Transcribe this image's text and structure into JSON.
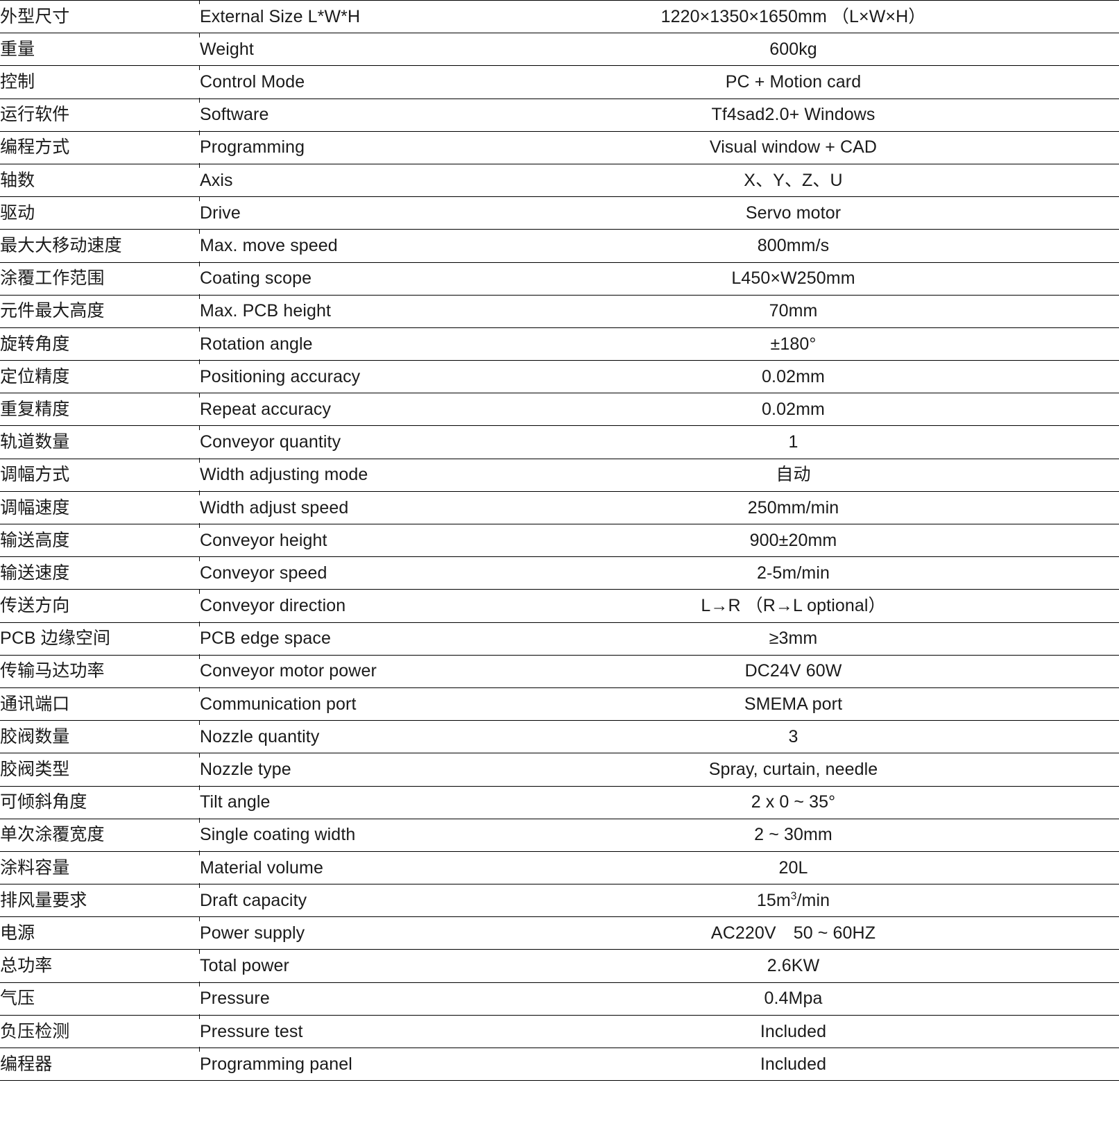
{
  "table": {
    "columns": [
      "label_cn",
      "label_en",
      "value"
    ],
    "rows": [
      {
        "label_cn": "外型尺寸",
        "label_en": "External Size L*W*H",
        "value": "1220×1350×1650mm （L×W×H）"
      },
      {
        "label_cn": "重量",
        "label_en": "Weight",
        "value": "600kg"
      },
      {
        "label_cn": "控制",
        "label_en": "Control Mode",
        "value": "PC + Motion card"
      },
      {
        "label_cn": "运行软件",
        "label_en": "Software",
        "value": "Tf4sad2.0+ Windows"
      },
      {
        "label_cn": "编程方式",
        "label_en": "Programming",
        "value": "Visual window + CAD"
      },
      {
        "label_cn": "轴数",
        "label_en": "Axis",
        "value": "X、Y、Z、U"
      },
      {
        "label_cn": "驱动",
        "label_en": "Drive",
        "value": "Servo motor"
      },
      {
        "label_cn": "最大大移动速度",
        "label_en": "Max. move speed",
        "value": "800mm/s"
      },
      {
        "label_cn": "涂覆工作范围",
        "label_en": "Coating scope",
        "value": "L450×W250mm"
      },
      {
        "label_cn": "元件最大高度",
        "label_en": "Max. PCB height",
        "value": "70mm"
      },
      {
        "label_cn": "旋转角度",
        "label_en": "Rotation angle",
        "value": "±180°"
      },
      {
        "label_cn": "定位精度",
        "label_en": "Positioning accuracy",
        "value": "0.02mm"
      },
      {
        "label_cn": "重复精度",
        "label_en": "Repeat accuracy",
        "value": "0.02mm"
      },
      {
        "label_cn": "轨道数量",
        "label_en": "Conveyor quantity",
        "value": "1"
      },
      {
        "label_cn": "调幅方式",
        "label_en": "Width adjusting mode",
        "value": "自动"
      },
      {
        "label_cn": "调幅速度",
        "label_en": "Width adjust speed",
        "value": "250mm/min"
      },
      {
        "label_cn": "输送高度",
        "label_en": "Conveyor height",
        "value": "900±20mm"
      },
      {
        "label_cn": "输送速度",
        "label_en": "Conveyor speed",
        "value": "2-5m/min"
      },
      {
        "label_cn": "传送方向",
        "label_en": "Conveyor direction",
        "value": "L→R  （R→L optional）"
      },
      {
        "label_cn": "PCB 边缘空间",
        "label_en": "PCB edge space",
        "value": "≥3mm"
      },
      {
        "label_cn": "传输马达功率",
        "label_en": "Conveyor motor power",
        "value": "DC24V 60W"
      },
      {
        "label_cn": "通讯端口",
        "label_en": "Communication port",
        "value": "SMEMA port"
      },
      {
        "label_cn": "胶阀数量",
        "label_en": "Nozzle quantity",
        "value": "3"
      },
      {
        "label_cn": "胶阀类型",
        "label_en": "Nozzle type",
        "value": "Spray, curtain, needle"
      },
      {
        "label_cn": "可倾斜角度",
        "label_en": "Tilt angle",
        "value": "2  x 0 ~ 35°"
      },
      {
        "label_cn": "单次涂覆宽度",
        "label_en": "Single coating width",
        "value": "2 ~ 30mm"
      },
      {
        "label_cn": "涂料容量",
        "label_en": "Material volume",
        "value": "20L"
      },
      {
        "label_cn": "排风量要求",
        "label_en": "Draft capacity",
        "value": "15m³/min",
        "value_html": "15m<sup>3</sup>/min"
      },
      {
        "label_cn": "电源",
        "label_en": "Power supply",
        "value": "AC220V　50 ~ 60HZ"
      },
      {
        "label_cn": "总功率",
        "label_en": "Total power",
        "value": "2.6KW"
      },
      {
        "label_cn": "气压",
        "label_en": "Pressure",
        "value": "0.4Mpa"
      },
      {
        "label_cn": "负压检测",
        "label_en": "Pressure test",
        "value": "Included"
      },
      {
        "label_cn": "编程器",
        "label_en": "Programming panel",
        "value": "Included"
      }
    ]
  }
}
